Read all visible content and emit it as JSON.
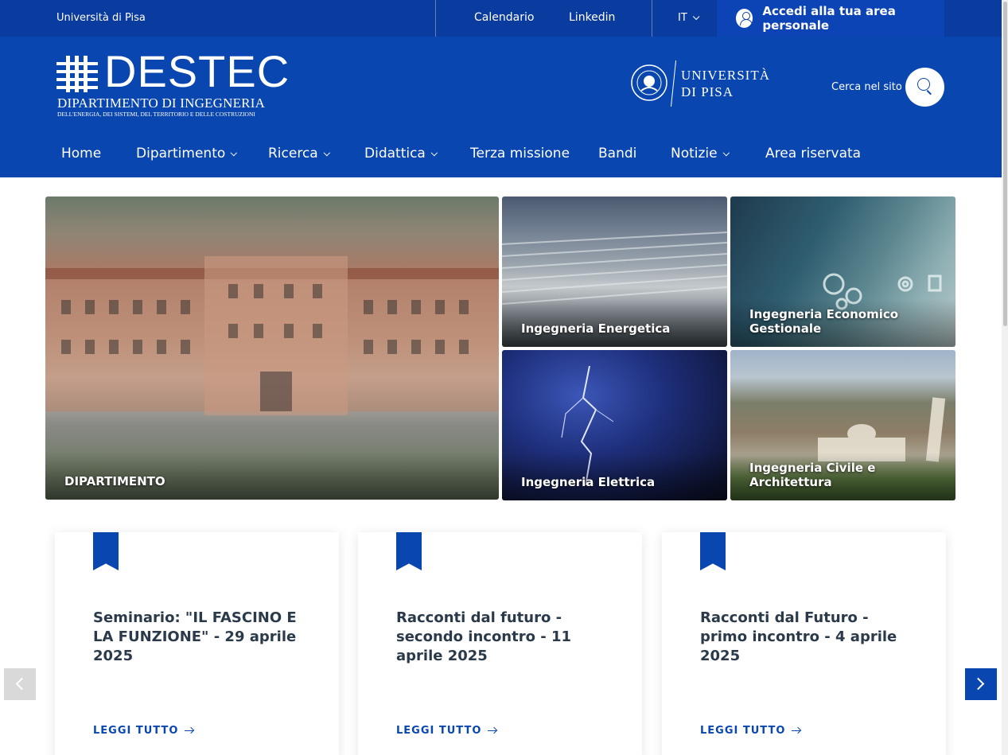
{
  "topbar": {
    "university": "Università di Pisa",
    "links": [
      "Calendario",
      "Linkedin"
    ],
    "language": "IT",
    "login": "Accedi alla tua area personale"
  },
  "header": {
    "logo_brand": "DESTEC",
    "logo_dept": "DIPARTIMENTO DI INGEGNERIA",
    "logo_sub": "DELL'ENERGIA, DEI SISTEMI, DEL TERRITORIO E DELLE COSTRUZIONI",
    "unipisa_line1": "UNIVERSITÀ",
    "unipisa_line2": "DI PISA",
    "search_label": "Cerca nel sito"
  },
  "nav": [
    {
      "label": "Home",
      "dropdown": false
    },
    {
      "label": "Dipartimento",
      "dropdown": true
    },
    {
      "label": "Ricerca",
      "dropdown": true
    },
    {
      "label": "Didattica",
      "dropdown": true
    },
    {
      "label": "Terza missione",
      "dropdown": false
    },
    {
      "label": "Bandi",
      "dropdown": false
    },
    {
      "label": "Notizie",
      "dropdown": true
    },
    {
      "label": "Area riservata",
      "dropdown": false
    }
  ],
  "tiles": [
    {
      "label": "DIPARTIMENTO"
    },
    {
      "label": "Ingegneria Energetica"
    },
    {
      "label": "Ingegneria Economico Gestionale"
    },
    {
      "label": "Ingegneria Elettrica"
    },
    {
      "label": "Ingegneria Civile e Architettura"
    }
  ],
  "news": [
    {
      "title": "Seminario: \"IL FASCINO E LA FUNZIONE\" - 29 aprile 2025",
      "more": "LEGGI TUTTO"
    },
    {
      "title": "Racconti dal futuro - secondo incontro - 11 aprile 2025",
      "more": "LEGGI TUTTO"
    },
    {
      "title": "Racconti dal Futuro - primo incontro - 4 aprile 2025",
      "more": "LEGGI TUTTO"
    }
  ],
  "colors": {
    "primary": "#0a46b0",
    "topbar": "#0a3b9e",
    "card_title": "#2b3a4a"
  }
}
